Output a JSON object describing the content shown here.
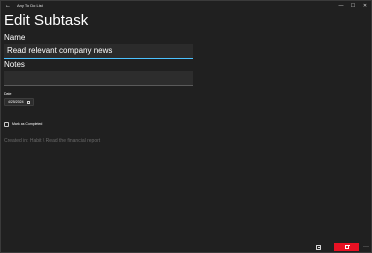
{
  "window": {
    "title": "Any To Do List",
    "back_glyph": "←",
    "controls": {
      "minimize_glyph": "—",
      "maximize_glyph": "☐",
      "close_glyph": "✕"
    }
  },
  "page": {
    "title": "Edit Subtask"
  },
  "form": {
    "name_label": "Name",
    "name_value": "Read relevant company news",
    "notes_label": "Notes",
    "notes_value": "",
    "date_label": "Date",
    "date_value": "4/25/2024",
    "mark_completed_label": "Mark as Completed",
    "mark_completed_checked": false
  },
  "footer": {
    "created_in_text": "Created in: Habit \\ Read the financial report"
  },
  "commandbar": {
    "more_glyph": "···"
  },
  "icons": {
    "back": "back-arrow-icon",
    "calendar": "calendar-icon",
    "save": "save-icon",
    "delete": "trash-icon"
  },
  "colors": {
    "background": "#202020",
    "accent": "#4cc2ff",
    "delete": "#e81123"
  }
}
